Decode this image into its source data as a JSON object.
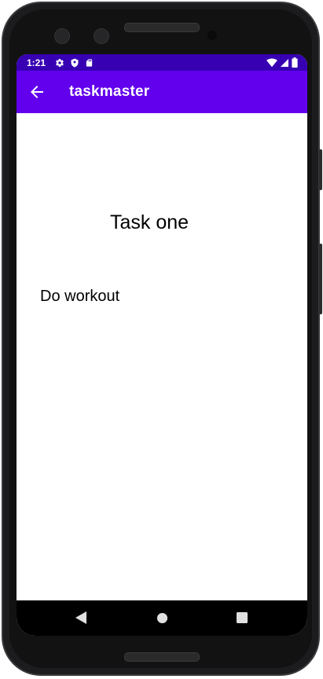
{
  "status_bar": {
    "time": "1:21",
    "background_color": "#3700b3",
    "left_icons": [
      "settings-icon",
      "shield-icon",
      "sd-card-icon"
    ],
    "right_icons": [
      "wifi-icon",
      "cell-signal-icon",
      "battery-icon"
    ]
  },
  "app_bar": {
    "title": "taskmaster",
    "background_color": "#6200ee",
    "back_icon": "arrow-back-icon"
  },
  "task": {
    "title": "Task one",
    "body": "Do workout"
  },
  "nav_bar": {
    "buttons": [
      "back-triangle-icon",
      "home-circle-icon",
      "recents-square-icon"
    ]
  }
}
